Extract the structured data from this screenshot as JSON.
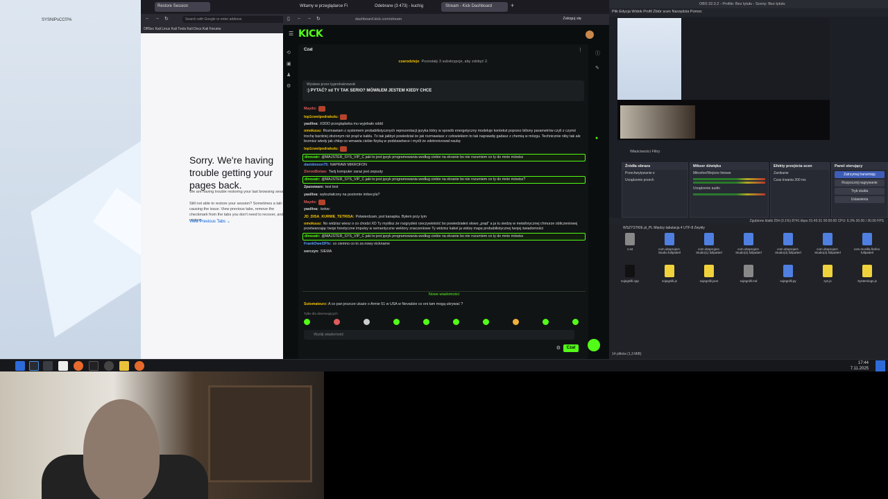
{
  "desktop": {
    "label": "SYSNIPsCC©%"
  },
  "taskbar": {
    "time": "17:44",
    "date": "7.11.2025"
  },
  "firefox": {
    "tabs": [
      "Restore Session"
    ],
    "url": "Search with Google or enter address",
    "bookmarks": "OffSec  Kali Linux  Kali Tools  Kali Docs  Kali Forums",
    "sorry_title": "Sorry. We're having trouble getting your pages back.",
    "sorry_p1": "We are having trouble restoring your last browsing session.",
    "sorry_p2": "Still not able to restore your session? Sometimes a tab is causing the issue. View previous tabs, remove the checkmark from the tabs you don't need to recover, and then restore.",
    "view_prev": "View Previous Tabs"
  },
  "kick": {
    "tabs": [
      "Witamy w przeglądarce Fi",
      "Odebrane (3 473) - kuchig",
      "Stream - Kick Dashboard"
    ],
    "url": "dashboard.kick.com/stream",
    "login": "Zaloguj się",
    "logo": "KICK",
    "chat_title": "Czat",
    "sub_user": "czarodziejo",
    "sub_goal": "Pozostały 3 subskrypcje, aby zdobyć 2.",
    "pinned_label": "Wysłane przez  tygerdraknowski",
    "pinned_text": ":) PYTAĆ? xd TY TAK SERIO? MÓWIŁEM JESTEM KIEDY CHCE",
    "messages": [
      {
        "user": "Maydo:",
        "color": "#e05b5b",
        "text": "",
        "emote": true,
        "hl": false
      },
      {
        "user": "top1cwelpodrakulu:",
        "color": "#f5c400",
        "text": "",
        "emote": true,
        "hl": false
      },
      {
        "user": "yasiliva:",
        "color": "#ddd",
        "text": "XDDD przeglądarka mu wyjebało xddd",
        "emote": false,
        "hl": false
      },
      {
        "user": "omokuuu:",
        "color": "#f5c400",
        "text": "Rozmawiam z systemem probabilistycznych reprezentacji języka który w sposób energetyczny modeluje kontekst poprzez biliony parametrów czyli z czymś trochę bardziej złożonym niż prąd w kablu. To tak jakbyś powiedział że jak rozmawiasz z człowiekiem to tak naprawdę gadasz z chemią w mózgu. Technicznie niby tak ale brzmisz wtedy jak chłop co wmawia ciebie fizyką w podstawówce i myśli że zdetronizował naukę",
        "emote": false,
        "hl": false
      },
      {
        "user": "top1cwelpodrakulu:",
        "color": "#f5c400",
        "text": "",
        "emote": true,
        "hl": false
      },
      {
        "user": "dinozatr:",
        "color": "#53fc18",
        "text": "@MAJSTER_SYS_VIP_C jaki to jest język programowania według ciebie na ekranie bo nie rozumiem co ty do mnie mówisz",
        "emote": false,
        "hl": true
      },
      {
        "user": "davidmoon75:",
        "color": "#5aa0ff",
        "text": "NAPRAW MIKROFON",
        "emote": false,
        "hl": false
      },
      {
        "user": "ZieronBolaw:",
        "color": "#e05b5b",
        "text": "Twój komputer zaraz jest zepsuty",
        "emote": false,
        "hl": false
      },
      {
        "user": "dinozatr:",
        "color": "#53fc18",
        "text": "@MAJSTER_SYS_VIP_C jaki to jest język programowania według ciebie na ekranie bo nie rozumiem co ty do mnie mówisz?",
        "emote": false,
        "hl": true
      },
      {
        "user": "2paxeware:",
        "color": "#ddd",
        "text": "test test",
        "emote": false,
        "hl": false
      },
      {
        "user": "yasiliva:",
        "color": "#ddd",
        "text": "wykształcony na poziomie imbecyla?",
        "emote": false,
        "hl": false
      },
      {
        "user": "Maydo:",
        "color": "#e05b5b",
        "text": "",
        "emote": true,
        "hl": false
      },
      {
        "user": "yasiliva:",
        "color": "#ddd",
        "text": ":kekw:",
        "emote": false,
        "hl": false
      },
      {
        "user": "JD_DISA_KURWE_TETRISA:",
        "color": "#f5c400",
        "text": "Potwierdzam, jest kanapka. Byłem przy tym",
        "emote": false,
        "hl": false
      },
      {
        "user": "omokuuu:",
        "color": "#f5c400",
        "text": "No widzisz wiesz o co chodzi XD Ty myślisz że rozgryzłeś rzeczywistość bo powiedziałeś słowo „prąd” a ja tu siedzę w metaforycznej chmurze obliczeniowej przetwarzając twoje fonetyczne impulsy w semantyczne wektory znaczeniowe Ty widzisz kabel ja widzę mapę probabilistycznej twojej świadomości",
        "emote": false,
        "hl": false
      },
      {
        "user": "dinozatr:",
        "color": "#53fc18",
        "text": "@MAJSTER_SYS_VIP_C jaki to jest język programowania według ciebie na ekranie bo nie rozumiem co ty do mnie mówisz",
        "emote": false,
        "hl": true
      },
      {
        "user": "FrankOwel2Ffe:",
        "color": "#5aa0ff",
        "text": "co ciemno co to za nowy nickname",
        "emote": false,
        "hl": false
      },
      {
        "user": "sorczyn:",
        "color": "#ddd",
        "text": "SIEMA",
        "emote": false,
        "hl": false
      }
    ],
    "new_messages": "Nowe wiadomości",
    "last_msg_user": "Sutomateurz:",
    "last_msg_text": "A co pan jeszcze ukaże o Armie 51 w USA w Nevadzie co oni tam mogą ukrywać ?",
    "only_subs": "Tylko dla obserwujących",
    "input_placeholder": "Wyślij wiadomość",
    "send_label": "Czat"
  },
  "obs": {
    "title": "OBS 32.0.2 - Profile: Bez tytułu - Sceny: Bez tytułu",
    "menu": "Plik  Edycja  Widok  Profil  Zbiór scen  Narzędzia  Pomoc",
    "tabs": "Właściwości   Filtry",
    "docks": {
      "sources": {
        "title": "Źródła obrazu",
        "items": [
          "Przechwytywanie e",
          "Urządzenie przech"
        ]
      },
      "mixer": {
        "title": "Mikser dźwięku",
        "items": [
          "Mikrofon/Wejście liniowe",
          "Urządzenie audio"
        ]
      },
      "transitions": {
        "title": "Efekty przejścia scen",
        "items": [
          "Zanikanie",
          "Czas trwania  300 ms"
        ]
      },
      "controls": {
        "title": "Panel sterujący",
        "items": [
          "Zatrzymaj transmisję",
          "Rozpocznij nagrywanie",
          "Tryb studia",
          "Ustawienia"
        ]
      }
    },
    "status": "Zgubione klatki 254 (0.1%)   8741 kbps   01:45:31   00:00:00   CPU: 6.3%   30.00 / 30.00 FPS",
    "files_bar": "WSZYSTKIE   pl_PL   Między tabulacja 4   UTF-8   Zwykły",
    "files": [
      {
        "name": "1.txt",
        "color": "#888"
      },
      {
        "name": "com.obsproject. Studio.fullpatterl",
        "color": "#4f7fe0"
      },
      {
        "name": "com.obsproject. Studio(1).fullpatterl",
        "color": "#4f7fe0"
      },
      {
        "name": "com.obsproject. Studio(2).fullpatterl",
        "color": "#4f7fe0"
      },
      {
        "name": "com.obsproject. Studio(3).fullpatterl",
        "color": "#4f7fe0"
      },
      {
        "name": "com.obsproject. Studio(4).fullpatterl",
        "color": "#4f7fe0"
      },
      {
        "name": "com.mozilla.firefox. fullpatterl",
        "color": "#4f7fe0"
      },
      {
        "name": "sojegnilli.cpp",
        "color": "#111"
      },
      {
        "name": "sojegnilli.js",
        "color": "#f0d23c"
      },
      {
        "name": "sojegnilli.json",
        "color": "#f0d23c"
      },
      {
        "name": "sojegnilli.md",
        "color": "#888"
      },
      {
        "name": "sojegnilli.py",
        "color": "#4f7fe0"
      },
      {
        "name": "sys.js",
        "color": "#f0d23c"
      },
      {
        "name": "Systemlogs.js",
        "color": "#f0d23c"
      }
    ],
    "files_count": "14 plików (1,3 MiB)"
  }
}
